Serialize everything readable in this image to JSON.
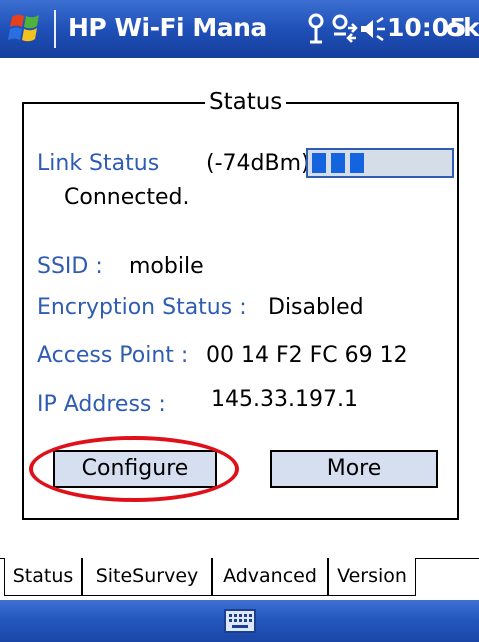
{
  "titlebar": {
    "app_title": "HP Wi-Fi Mana",
    "clock": "10:05",
    "ok_label": "ok",
    "icons": [
      "windows-start-icon",
      "antenna-icon",
      "connectivity-icon",
      "speaker-icon"
    ]
  },
  "status_group": {
    "title": "Status",
    "link_status_label": "Link Status",
    "signal_strength": "(-74dBm)",
    "signal_bars_filled": 3,
    "connection_state": "Connected.",
    "ssid_label": "SSID :",
    "ssid_value": "mobile",
    "encryption_label": "Encryption Status :",
    "encryption_value": "Disabled",
    "access_point_label": "Access Point :",
    "access_point_value": "00 14 F2 FC 69 12",
    "ip_label": "IP Address :",
    "ip_value": "145.33.197.1",
    "configure_label": "Configure",
    "more_label": "More"
  },
  "tabs": [
    {
      "label": "Status",
      "active": true
    },
    {
      "label": "SiteSurvey",
      "active": false
    },
    {
      "label": "Advanced",
      "active": false
    },
    {
      "label": "Version",
      "active": false
    }
  ],
  "colors": {
    "titlebar": "#1f50b8",
    "label_blue": "#2f5cb3",
    "signal_fill": "#1464e0",
    "button_bg": "#d6dff0",
    "highlight": "#e0101a"
  }
}
